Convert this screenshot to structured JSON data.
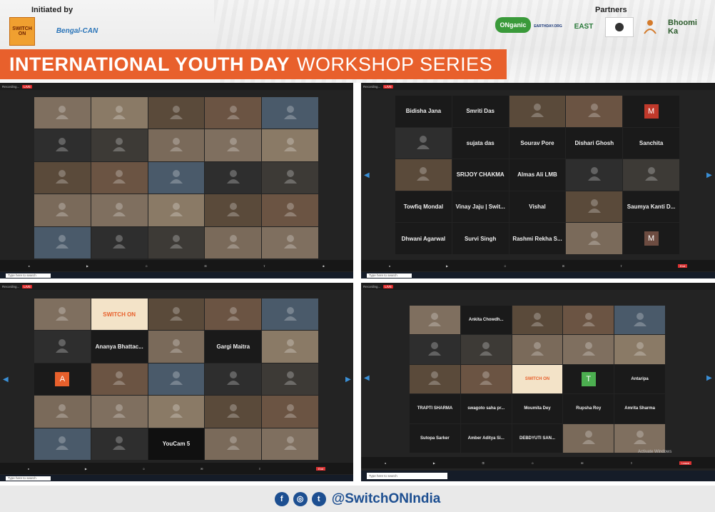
{
  "header": {
    "initiated_by": "Initiated by",
    "partners": "Partners",
    "title_bold": "INTERNATIONAL YOUTH DAY",
    "title_regular": "WORKSHOP SERIES",
    "logos": {
      "switch_on": "SWITCH ON",
      "bengal_can": "Bengal-CAN",
      "onganic": "ONganic",
      "earthday": "EARTHDAY.ORG",
      "east": "EAST",
      "bhoomi": "Bhoomi Ka"
    }
  },
  "screens": {
    "top_right_tiles": [
      "Bidisha Jana",
      "Smriti Das",
      "",
      "",
      "M",
      "",
      "sujata das",
      "Sourav Pore",
      "Dishari Ghosh",
      "Sanchita",
      "",
      "SRIJOY CHAKMA",
      "Almas Ali LMB",
      "",
      "",
      "Towfiq Mondal",
      "Vinay Jaju | Swit...",
      "Vishal",
      "",
      "Saumya Kanti D...",
      "Dhwani Agarwal",
      "Survi Singh",
      "Rashmi Rekha S...",
      "",
      "M"
    ],
    "bottom_left_tiles": [
      "",
      "SWITCH ON",
      "",
      "",
      "",
      "",
      "Ananya Bhattac...",
      "",
      "Gargi Maitra",
      "",
      "A",
      "",
      "",
      "",
      "",
      "",
      "",
      "",
      "",
      "",
      "",
      "",
      "YouCam 5",
      "",
      ""
    ],
    "bottom_right_tiles": [
      "",
      "Ankita Chowdh...",
      "",
      "",
      "",
      "",
      "",
      "",
      "",
      "",
      "",
      "",
      "SWITCH ON",
      "T",
      "Antaripa",
      "TRAPTI SHARMA",
      "swagoto saha pr...",
      "Moumita Dey",
      "Rupsha Roy",
      "Amrita Sharma",
      "Sutopa Sarker",
      "Amber Aditya Si...",
      "DEBDYUTI SAN...",
      "",
      ""
    ],
    "recording_label": "Recording...",
    "live_label": "LIVE",
    "search_label": "Type here to search",
    "activate_windows": "Activate Windows",
    "leave_label": "Leave",
    "end_label": "End"
  },
  "footer": {
    "handle": "@SwitchONIndia",
    "icons": [
      "facebook-icon",
      "instagram-icon",
      "twitter-icon"
    ]
  }
}
